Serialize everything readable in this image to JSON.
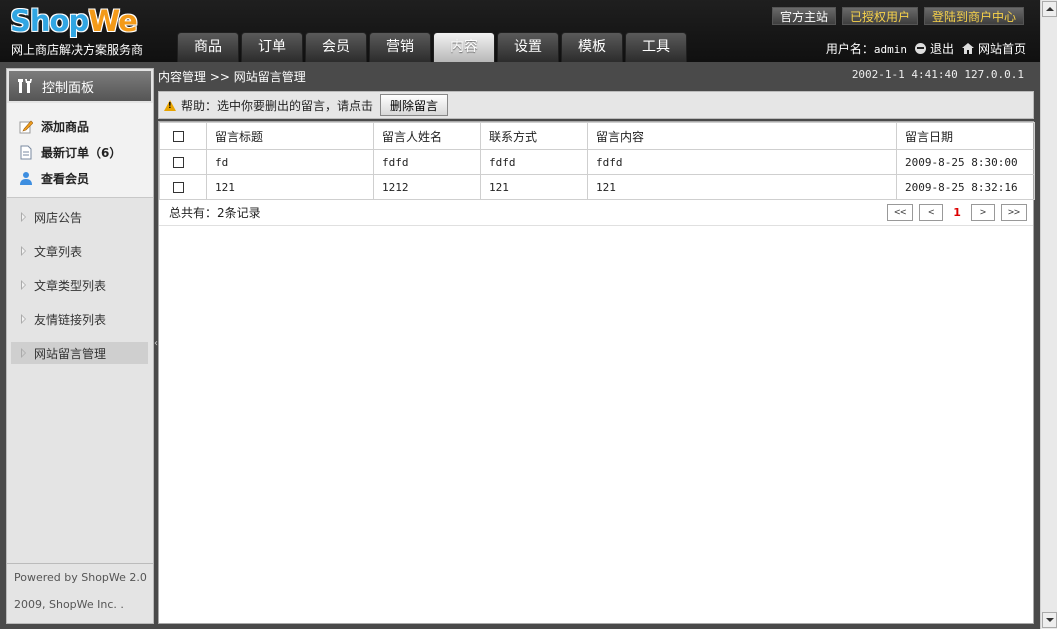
{
  "brand": {
    "logo_part1": "Shop",
    "logo_part2": "We",
    "tagline": "网上商店解决方案服务商"
  },
  "top_links": [
    "官方主站",
    "已授权用户",
    "登陆到商户中心"
  ],
  "nav_tabs": [
    "商品",
    "订单",
    "会员",
    "营销",
    "内容",
    "设置",
    "模板",
    "工具"
  ],
  "active_tab": "内容",
  "user_bar": {
    "label": "用户名：",
    "username": "admin",
    "logout": "退出",
    "home": "网站首页"
  },
  "sidebar": {
    "title": "控制面板",
    "quick_links": [
      {
        "label": "添加商品",
        "icon": "edit-icon"
      },
      {
        "label": "最新订单（6）",
        "icon": "document-icon"
      },
      {
        "label": "查看会员",
        "icon": "user-icon"
      }
    ],
    "menu": [
      "网店公告",
      "文章列表",
      "文章类型列表",
      "友情链接列表",
      "网站留言管理"
    ],
    "active_menu": "网站留言管理",
    "footer": [
      "Powered by ShopWe 2.0",
      "2009, ShopWe Inc. ."
    ]
  },
  "breadcrumb": "内容管理 >> 网站留言管理",
  "datetime": "2002-1-1 4:41:40 127.0.0.1",
  "help": {
    "text": "帮助：选中你要删出的留言，请点击",
    "button": "删除留言"
  },
  "table": {
    "columns": [
      "留言标题",
      "留言人姓名",
      "联系方式",
      "留言内容",
      "留言日期"
    ],
    "rows": [
      [
        "fd",
        "fdfd",
        "fdfd",
        "fdfd",
        "2009-8-25 8:30:00"
      ],
      [
        "121",
        "1212",
        "121",
        "121",
        "2009-8-25 8:32:16"
      ]
    ]
  },
  "pagination": {
    "total": "总共有：2条记录",
    "first": "<<",
    "prev": "<",
    "current": "1",
    "next": ">",
    "last": ">>"
  },
  "colors": {
    "header_bg": "#1a1a1a",
    "active_tab": "#e0e0e0",
    "gold_link": "#f7d24a",
    "page_current": "#dd0000"
  }
}
